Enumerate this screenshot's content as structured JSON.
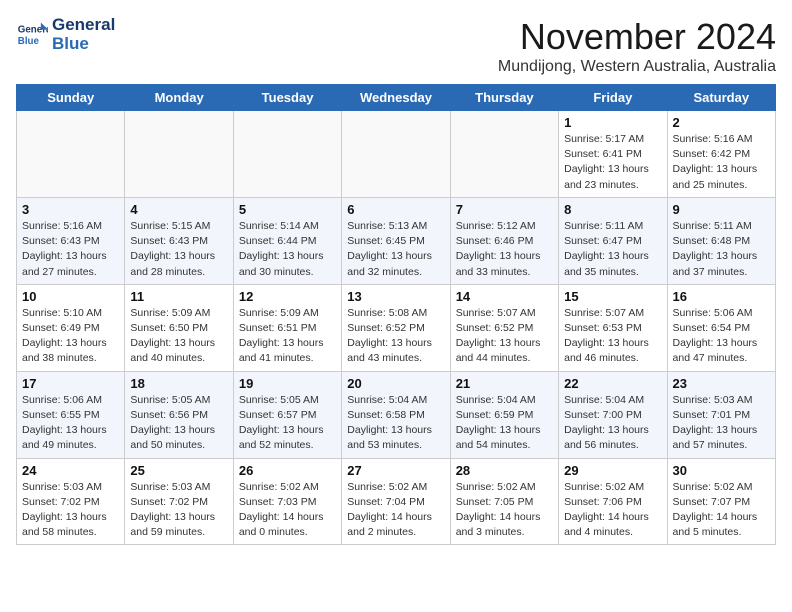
{
  "logo": {
    "line1": "General",
    "line2": "Blue"
  },
  "title": "November 2024",
  "subtitle": "Mundijong, Western Australia, Australia",
  "headers": [
    "Sunday",
    "Monday",
    "Tuesday",
    "Wednesday",
    "Thursday",
    "Friday",
    "Saturday"
  ],
  "weeks": [
    [
      {
        "day": "",
        "info": ""
      },
      {
        "day": "",
        "info": ""
      },
      {
        "day": "",
        "info": ""
      },
      {
        "day": "",
        "info": ""
      },
      {
        "day": "",
        "info": ""
      },
      {
        "day": "1",
        "info": "Sunrise: 5:17 AM\nSunset: 6:41 PM\nDaylight: 13 hours\nand 23 minutes."
      },
      {
        "day": "2",
        "info": "Sunrise: 5:16 AM\nSunset: 6:42 PM\nDaylight: 13 hours\nand 25 minutes."
      }
    ],
    [
      {
        "day": "3",
        "info": "Sunrise: 5:16 AM\nSunset: 6:43 PM\nDaylight: 13 hours\nand 27 minutes."
      },
      {
        "day": "4",
        "info": "Sunrise: 5:15 AM\nSunset: 6:43 PM\nDaylight: 13 hours\nand 28 minutes."
      },
      {
        "day": "5",
        "info": "Sunrise: 5:14 AM\nSunset: 6:44 PM\nDaylight: 13 hours\nand 30 minutes."
      },
      {
        "day": "6",
        "info": "Sunrise: 5:13 AM\nSunset: 6:45 PM\nDaylight: 13 hours\nand 32 minutes."
      },
      {
        "day": "7",
        "info": "Sunrise: 5:12 AM\nSunset: 6:46 PM\nDaylight: 13 hours\nand 33 minutes."
      },
      {
        "day": "8",
        "info": "Sunrise: 5:11 AM\nSunset: 6:47 PM\nDaylight: 13 hours\nand 35 minutes."
      },
      {
        "day": "9",
        "info": "Sunrise: 5:11 AM\nSunset: 6:48 PM\nDaylight: 13 hours\nand 37 minutes."
      }
    ],
    [
      {
        "day": "10",
        "info": "Sunrise: 5:10 AM\nSunset: 6:49 PM\nDaylight: 13 hours\nand 38 minutes."
      },
      {
        "day": "11",
        "info": "Sunrise: 5:09 AM\nSunset: 6:50 PM\nDaylight: 13 hours\nand 40 minutes."
      },
      {
        "day": "12",
        "info": "Sunrise: 5:09 AM\nSunset: 6:51 PM\nDaylight: 13 hours\nand 41 minutes."
      },
      {
        "day": "13",
        "info": "Sunrise: 5:08 AM\nSunset: 6:52 PM\nDaylight: 13 hours\nand 43 minutes."
      },
      {
        "day": "14",
        "info": "Sunrise: 5:07 AM\nSunset: 6:52 PM\nDaylight: 13 hours\nand 44 minutes."
      },
      {
        "day": "15",
        "info": "Sunrise: 5:07 AM\nSunset: 6:53 PM\nDaylight: 13 hours\nand 46 minutes."
      },
      {
        "day": "16",
        "info": "Sunrise: 5:06 AM\nSunset: 6:54 PM\nDaylight: 13 hours\nand 47 minutes."
      }
    ],
    [
      {
        "day": "17",
        "info": "Sunrise: 5:06 AM\nSunset: 6:55 PM\nDaylight: 13 hours\nand 49 minutes."
      },
      {
        "day": "18",
        "info": "Sunrise: 5:05 AM\nSunset: 6:56 PM\nDaylight: 13 hours\nand 50 minutes."
      },
      {
        "day": "19",
        "info": "Sunrise: 5:05 AM\nSunset: 6:57 PM\nDaylight: 13 hours\nand 52 minutes."
      },
      {
        "day": "20",
        "info": "Sunrise: 5:04 AM\nSunset: 6:58 PM\nDaylight: 13 hours\nand 53 minutes."
      },
      {
        "day": "21",
        "info": "Sunrise: 5:04 AM\nSunset: 6:59 PM\nDaylight: 13 hours\nand 54 minutes."
      },
      {
        "day": "22",
        "info": "Sunrise: 5:04 AM\nSunset: 7:00 PM\nDaylight: 13 hours\nand 56 minutes."
      },
      {
        "day": "23",
        "info": "Sunrise: 5:03 AM\nSunset: 7:01 PM\nDaylight: 13 hours\nand 57 minutes."
      }
    ],
    [
      {
        "day": "24",
        "info": "Sunrise: 5:03 AM\nSunset: 7:02 PM\nDaylight: 13 hours\nand 58 minutes."
      },
      {
        "day": "25",
        "info": "Sunrise: 5:03 AM\nSunset: 7:02 PM\nDaylight: 13 hours\nand 59 minutes."
      },
      {
        "day": "26",
        "info": "Sunrise: 5:02 AM\nSunset: 7:03 PM\nDaylight: 14 hours\nand 0 minutes."
      },
      {
        "day": "27",
        "info": "Sunrise: 5:02 AM\nSunset: 7:04 PM\nDaylight: 14 hours\nand 2 minutes."
      },
      {
        "day": "28",
        "info": "Sunrise: 5:02 AM\nSunset: 7:05 PM\nDaylight: 14 hours\nand 3 minutes."
      },
      {
        "day": "29",
        "info": "Sunrise: 5:02 AM\nSunset: 7:06 PM\nDaylight: 14 hours\nand 4 minutes."
      },
      {
        "day": "30",
        "info": "Sunrise: 5:02 AM\nSunset: 7:07 PM\nDaylight: 14 hours\nand 5 minutes."
      }
    ]
  ]
}
